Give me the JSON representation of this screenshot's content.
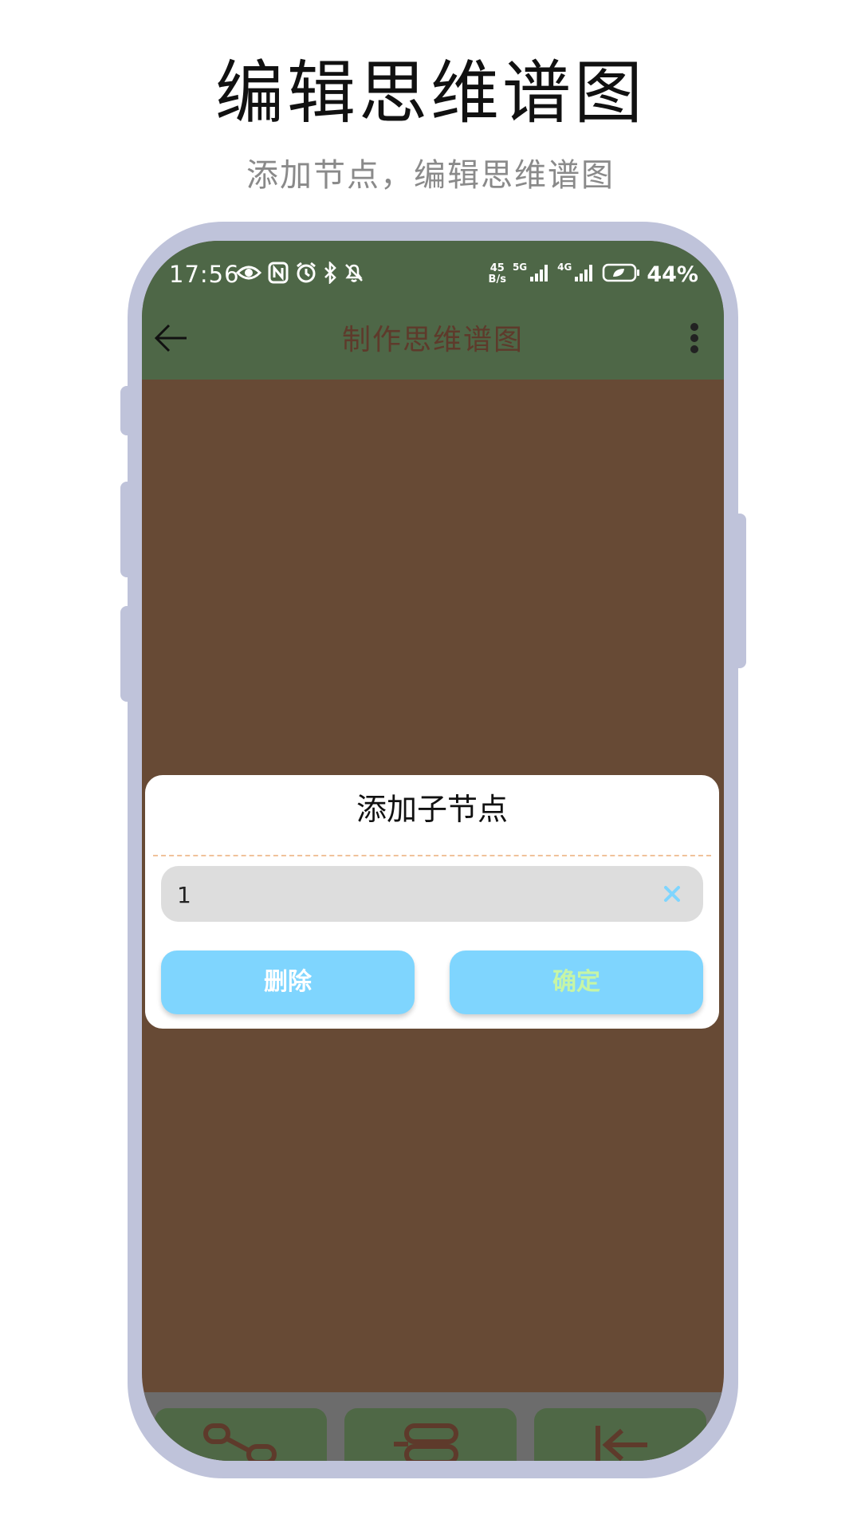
{
  "promo": {
    "title": "编辑思维谱图",
    "subtitle": "添加节点，编辑思维谱图"
  },
  "status_bar": {
    "time": "17:56",
    "net_speed_value": "45",
    "net_speed_unit": "B/s",
    "sim1_label": "5G",
    "sim2_label": "4G",
    "battery": "44%",
    "icons_left": [
      "eye-icon",
      "nfc-icon",
      "alarm-icon",
      "bluetooth-icon",
      "bell-off-icon"
    ],
    "icons_right": [
      "net-speed",
      "signal-5g-icon",
      "signal-4g-icon",
      "battery-leaf-icon"
    ]
  },
  "app_bar": {
    "title": "制作思维谱图",
    "back_icon": "arrow-left-icon",
    "more_icon": "more-vertical-icon"
  },
  "dialog": {
    "title": "添加子节点",
    "input_value": "1",
    "clear_icon": "clear-x-icon",
    "delete_label": "删除",
    "confirm_label": "确定"
  },
  "toolbar": {
    "icons": [
      "add-child-node-icon",
      "add-sibling-node-icon",
      "back-to-root-icon"
    ]
  },
  "colors": {
    "app_bar": "#4e6747",
    "canvas": "#674a35",
    "title_text": "#5e3a2b",
    "dialog_button": "#7fd5fe",
    "confirm_text": "#c6f5a6",
    "clear_icon": "#7fd5fe",
    "toolbar_bg": "#6c6c6c",
    "toolbar_button": "#4f6846",
    "phone_frame": "#bfc3da"
  }
}
